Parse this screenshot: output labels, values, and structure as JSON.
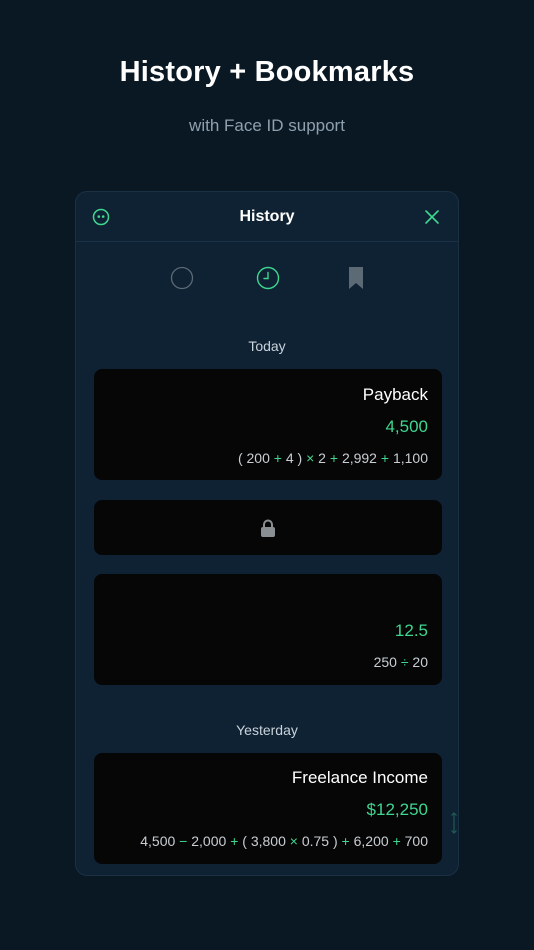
{
  "hero": {
    "title": "History + Bookmarks",
    "subtitle": "with Face ID support"
  },
  "panel": {
    "title": "History",
    "tabs": [
      {
        "name": "all",
        "icon": "circle-icon",
        "active": false
      },
      {
        "name": "history",
        "icon": "clock-icon",
        "active": true
      },
      {
        "name": "bookmarks",
        "icon": "bookmark-icon",
        "active": false
      }
    ]
  },
  "sections": {
    "today": "Today",
    "yesterday": "Yesterday"
  },
  "entries": {
    "payback": {
      "title": "Payback",
      "result": "4,500",
      "expr": [
        "(",
        "200",
        "+",
        "4",
        ")",
        "×",
        "2",
        "+",
        "2,992",
        "+",
        "1,100"
      ]
    },
    "locked": {
      "icon": "lock-icon"
    },
    "division": {
      "result": "12.5",
      "expr": [
        "250",
        "÷",
        "20"
      ]
    },
    "freelance": {
      "title": "Freelance Income",
      "result": "$12,250",
      "expr": [
        "4,500",
        "−",
        "2,000",
        "+",
        "(",
        "3,800",
        "×",
        "0.75",
        ")",
        "+",
        "6,200",
        "+",
        "700"
      ]
    }
  },
  "colors": {
    "background": "#0a1824",
    "panel": "#0f2234",
    "accent": "#3fd68f",
    "card": "#060606"
  }
}
